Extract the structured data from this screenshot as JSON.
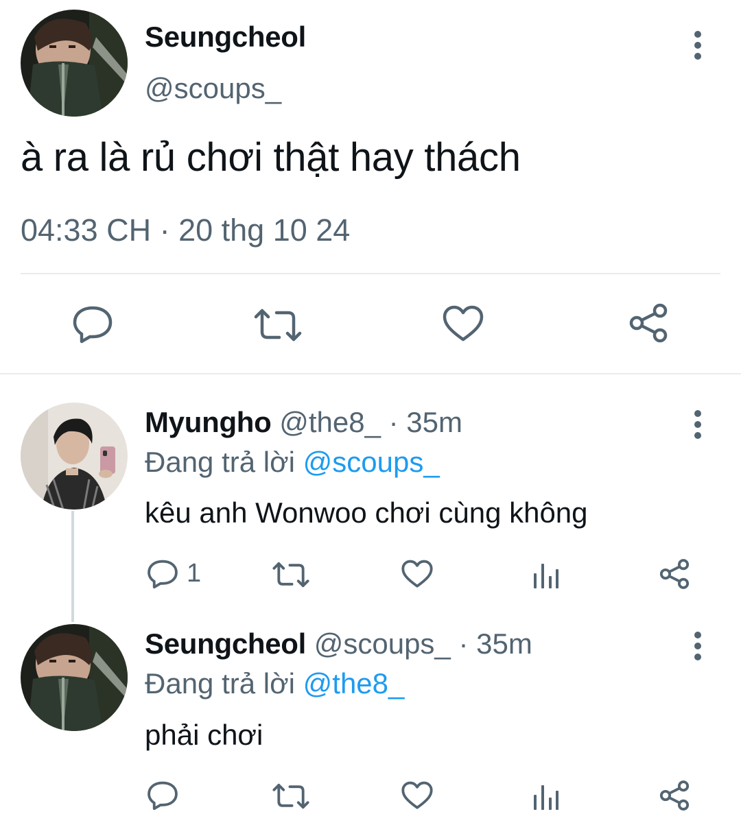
{
  "main_tweet": {
    "author_name": "Seungcheol",
    "author_handle": "@scoups_",
    "text": "à ra là rủ chơi thật hay thách",
    "timestamp": "04:33 CH · 20 thg 10 24",
    "actions": [
      "reply-icon",
      "retweet-icon",
      "like-icon",
      "share-icon"
    ]
  },
  "replies": [
    {
      "author_name": "Myungho",
      "author_handle": "@the8_",
      "separator": " · ",
      "time": "35m",
      "replying_prefix": "Đang trả lời ",
      "replying_to": "@scoups_",
      "text": "kêu anh Wonwoo chơi cùng không",
      "reply_count": "1"
    },
    {
      "author_name": "Seungcheol",
      "author_handle": "@scoups_",
      "separator": " · ",
      "time": "35m",
      "replying_prefix": "Đang trả lời ",
      "replying_to": "@the8_",
      "text": "phải chơi",
      "reply_count": ""
    }
  ],
  "colors": {
    "text_primary": "#0f1419",
    "text_secondary": "#536471",
    "mention": "#1d9bf0",
    "divider": "#e6ecf0"
  }
}
